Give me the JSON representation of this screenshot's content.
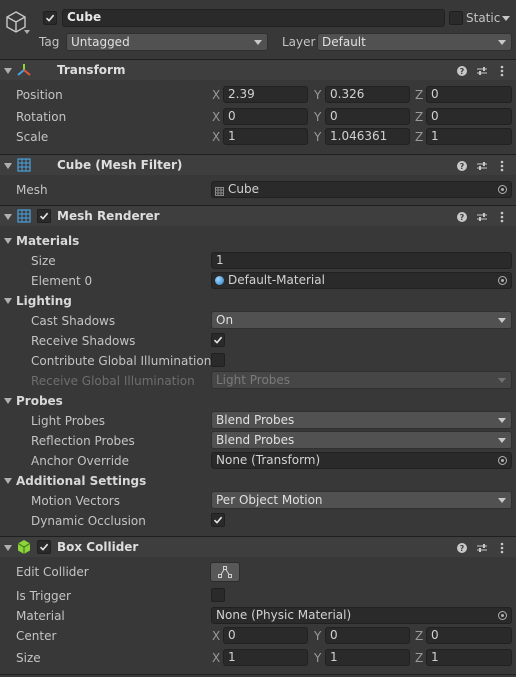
{
  "object": {
    "name": "Cube",
    "active": true,
    "static_label": "Static",
    "static_checked": false,
    "tag_label": "Tag",
    "tag_value": "Untagged",
    "layer_label": "Layer",
    "layer_value": "Default"
  },
  "transform": {
    "title": "Transform",
    "position_label": "Position",
    "rotation_label": "Rotation",
    "scale_label": "Scale",
    "axes": [
      "X",
      "Y",
      "Z"
    ],
    "position": [
      "2.39",
      "0.326",
      "0"
    ],
    "rotation": [
      "0",
      "0",
      "0"
    ],
    "scale": [
      "1",
      "1.046361",
      "1"
    ]
  },
  "mesh_filter": {
    "title": "Cube (Mesh Filter)",
    "mesh_label": "Mesh",
    "mesh_value": "Cube"
  },
  "mesh_renderer": {
    "title": "Mesh Renderer",
    "enabled": true,
    "materials_label": "Materials",
    "size_label": "Size",
    "size_value": "1",
    "element0_label": "Element 0",
    "element0_value": "Default-Material",
    "lighting_label": "Lighting",
    "cast_shadows_label": "Cast Shadows",
    "cast_shadows_value": "On",
    "receive_shadows_label": "Receive Shadows",
    "receive_shadows_checked": true,
    "contribute_gi_label": "Contribute Global Illumination",
    "contribute_gi_checked": false,
    "receive_gi_label": "Receive Global Illumination",
    "receive_gi_value": "Light Probes",
    "probes_label": "Probes",
    "light_probes_label": "Light Probes",
    "light_probes_value": "Blend Probes",
    "reflection_probes_label": "Reflection Probes",
    "reflection_probes_value": "Blend Probes",
    "anchor_override_label": "Anchor Override",
    "anchor_override_value": "None (Transform)",
    "additional_label": "Additional Settings",
    "motion_vectors_label": "Motion Vectors",
    "motion_vectors_value": "Per Object Motion",
    "dynamic_occlusion_label": "Dynamic Occlusion",
    "dynamic_occlusion_checked": true
  },
  "box_collider": {
    "title": "Box Collider",
    "enabled": true,
    "edit_collider_label": "Edit Collider",
    "is_trigger_label": "Is Trigger",
    "is_trigger_checked": false,
    "material_label": "Material",
    "material_value": "None (Physic Material)",
    "center_label": "Center",
    "size_label": "Size",
    "axes": [
      "X",
      "Y",
      "Z"
    ],
    "center": [
      "0",
      "0",
      "0"
    ],
    "size": [
      "1",
      "1",
      "1"
    ]
  },
  "colors": {
    "panel": "#383838",
    "header": "#3e3e3e",
    "field": "#2a2a2a",
    "accent_green": "#8bd43a",
    "accent_blue": "#4aa3df"
  },
  "icons": {
    "object": "cube-outline-icon",
    "transform": "transform-axes-icon",
    "mesh_filter": "grid-icon",
    "mesh_renderer": "grid-icon",
    "box_collider": "green-cube-icon",
    "help": "help-icon",
    "presets": "sliders-icon",
    "menu": "kebab-menu-icon",
    "target": "object-picker-icon"
  }
}
